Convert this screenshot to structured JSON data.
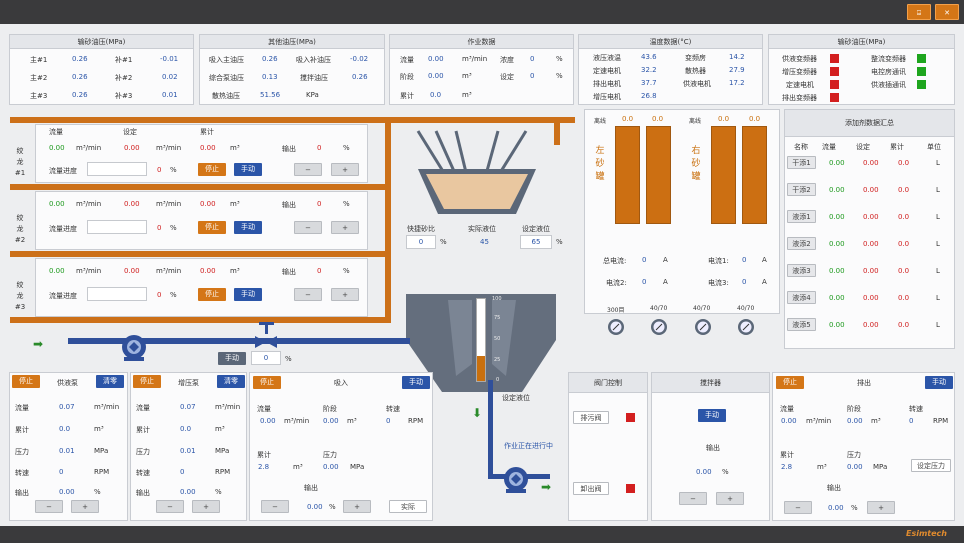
{
  "window": {
    "exit_glyph": "⍈",
    "close_glyph": "✕",
    "brand": "Esimtech"
  },
  "sand_pressure": {
    "title": "输砂油压(MPa)",
    "r1": [
      "主#1",
      "0.26",
      "补#1",
      "-0.01"
    ],
    "r2": [
      "主#2",
      "0.26",
      "补#2",
      "0.02"
    ],
    "r3": [
      "主#3",
      "0.26",
      "补#3",
      "0.01"
    ]
  },
  "other_pressure": {
    "title": "其他油压(MPa)",
    "r1": [
      "吸入主油压",
      "0.26",
      "吸入补油压",
      "-0.02"
    ],
    "r2": [
      "综合泵油压",
      "0.13",
      "搅拌油压",
      "0.26"
    ],
    "r3": [
      "散热油压",
      "51.56",
      "KPa"
    ]
  },
  "work_data": {
    "title": "作业数据",
    "r1": [
      "流量",
      "0.00",
      "m³/min",
      "浓度",
      "0",
      "%"
    ],
    "r2": [
      "阶段",
      "0.00",
      "m³",
      "设定",
      "0",
      "%"
    ],
    "r3": [
      "累计",
      "0.0",
      "m³"
    ]
  },
  "temp_data": {
    "title": "温度数据(°C)",
    "r1": [
      "液压液温",
      "43.6",
      "变频房",
      "14.2"
    ],
    "r2": [
      "定速电机",
      "32.2",
      "散热器",
      "27.9"
    ],
    "r3": [
      "排出电机",
      "37.7",
      "供液电机",
      "17.2"
    ],
    "r4": [
      "增压电机",
      "26.8"
    ]
  },
  "sand_status": {
    "title": "输砂油压(MPa)",
    "l": [
      "供液变频器",
      "增压变频器",
      "定速电机",
      "排出变频器"
    ],
    "rt": [
      "整流变频器",
      "电控房通讯",
      "供液插通讯"
    ]
  },
  "colors": {
    "red_led": "#d31f1f",
    "green_led": "#1ea51e",
    "pipe": "#cc7019",
    "water": "#2f4f9a"
  },
  "augers": [
    {
      "name": [
        "绞",
        "龙",
        "#1"
      ],
      "h_flow": "流量",
      "h_set": "设定",
      "h_acc": "累计",
      "flow": "0.00",
      "flow_u": "m³/min",
      "set": "0.00",
      "set_u": "m³/min",
      "acc": "0.00",
      "acc_u": "m³",
      "out_l": "输出",
      "out": "0",
      "out_u": "%",
      "prog_l": "流量进度",
      "prog": "0",
      "prog_u": "%",
      "stop": "停止",
      "manual": "手动",
      "minus": "−",
      "plus": "+"
    },
    {
      "name": [
        "绞",
        "龙",
        "#2"
      ],
      "flow": "0.00",
      "flow_u": "m³/min",
      "set": "0.00",
      "set_u": "m³/min",
      "acc": "0.00",
      "acc_u": "m³",
      "out_l": "输出",
      "out": "0",
      "out_u": "%",
      "prog_l": "流量进度",
      "prog": "0",
      "prog_u": "%",
      "stop": "停止",
      "manual": "手动",
      "minus": "−",
      "plus": "+"
    },
    {
      "name": [
        "绞",
        "龙",
        "#3"
      ],
      "flow": "0.00",
      "flow_u": "m³/min",
      "set": "0.00",
      "set_u": "m³/min",
      "acc": "0.00",
      "acc_u": "m³",
      "out_l": "输出",
      "out": "0",
      "out_u": "%",
      "prog_l": "流量进度",
      "prog": "0",
      "prog_u": "%",
      "stop": "停止",
      "manual": "手动",
      "minus": "−",
      "plus": "+"
    }
  ],
  "hopper": {
    "fast_l": "快捷砂比",
    "fast": "0",
    "fast_u": "%",
    "real_l": "实际液位",
    "real": "45",
    "set_l": "设定液位",
    "set": "65",
    "set_u": "%",
    "ticks": [
      "100",
      "75",
      "50",
      "25",
      "0"
    ],
    "level": 0.3,
    "set_level_l": "设定液位",
    "status": "作业正在进行中"
  },
  "valve": {
    "manual": "手动",
    "val": "0",
    "unit": "%"
  },
  "sand_tanks": {
    "left": [
      "左",
      "砂",
      "罐"
    ],
    "right": [
      "右",
      "砂",
      "罐"
    ],
    "rl": [
      "离线",
      "离线"
    ],
    "vals": [
      "0.0",
      "0.0",
      "0.0",
      "0.0"
    ],
    "total_i": "总电流:",
    "ti": "0",
    "a": "A",
    "i2": "电流2:",
    "i2v": "0",
    "i1": "电流1:",
    "i1v": "0",
    "i3": "电流3:",
    "i3v": "0",
    "gauges": [
      "300目",
      "40/70",
      "40/70",
      "40/70"
    ]
  },
  "additive": {
    "title": "添加剂数据汇总",
    "cols": [
      "名称",
      "流量",
      "设定",
      "累计",
      "单位"
    ],
    "rows": [
      [
        "干添1",
        "0.00",
        "0.00",
        "0.0",
        "L"
      ],
      [
        "干添2",
        "0.00",
        "0.00",
        "0.0",
        "L"
      ],
      [
        "液添1",
        "0.00",
        "0.00",
        "0.0",
        "L"
      ],
      [
        "液添2",
        "0.00",
        "0.00",
        "0.0",
        "L"
      ],
      [
        "液添3",
        "0.00",
        "0.00",
        "0.0",
        "L"
      ],
      [
        "液添4",
        "0.00",
        "0.00",
        "0.0",
        "L"
      ],
      [
        "液添5",
        "0.00",
        "0.00",
        "0.0",
        "L"
      ]
    ]
  },
  "supply": {
    "stop": "停止",
    "title": "供液泵",
    "clear": "清零",
    "flow_l": "流量",
    "flow": "0.07",
    "flow_u": "m³/min",
    "acc_l": "累计",
    "acc": "0.0",
    "acc_u": "m³",
    "pres_l": "压力",
    "pres": "0.01",
    "pres_u": "MPa",
    "rpm_l": "转速",
    "rpm": "0",
    "rpm_u": "RPM",
    "out_l": "输出",
    "out": "0.00",
    "out_u": "%"
  },
  "boost": {
    "stop": "停止",
    "title": "增压泵",
    "clear": "清零",
    "flow_l": "流量",
    "flow": "0.07",
    "flow_u": "m³/min",
    "acc_l": "累计",
    "acc": "0.0",
    "acc_u": "m³",
    "pres_l": "压力",
    "pres": "0.01",
    "pres_u": "MPa",
    "rpm_l": "转速",
    "rpm": "0",
    "rpm_u": "RPM",
    "out_l": "输出",
    "out": "0.00",
    "out_u": "%"
  },
  "suction": {
    "stop": "停止",
    "title": "吸入",
    "manual": "手动",
    "flow_l": "流量",
    "flow": "0.00",
    "flow_u": "m³/min",
    "stage_l": "阶段",
    "stage": "0.00",
    "stage_u": "m³",
    "rpm_l": "转速",
    "rpm": "0",
    "rpm_u": "RPM",
    "acc_l": "累计",
    "acc": "2.8",
    "acc_u": "m³",
    "pres_l": "压力",
    "pres": "0.00",
    "pres_u": "MPa",
    "out_l": "输出",
    "out": "0.00",
    "out_u": "%",
    "real": "实际"
  },
  "valves": {
    "title": "阀门控制",
    "v1": "排污阀",
    "v2": "卸出阀"
  },
  "mixer": {
    "title": "搅拌器",
    "manual": "手动",
    "out_l": "输出",
    "out": "0.00",
    "out_u": "%"
  },
  "discharge": {
    "stop": "停止",
    "title": "排出",
    "manual": "手动",
    "flow_l": "流量",
    "flow": "0.00",
    "flow_u": "m³/min",
    "stage_l": "阶段",
    "stage": "0.00",
    "stage_u": "m³",
    "rpm_l": "转速",
    "rpm": "0",
    "rpm_u": "RPM",
    "acc_l": "累计",
    "acc": "2.8",
    "acc_u": "m³",
    "pres_l": "压力",
    "pres": "0.00",
    "pres_u": "MPa",
    "set_p": "设定压力",
    "out_l": "输出",
    "out": "0.00",
    "out_u": "%"
  }
}
